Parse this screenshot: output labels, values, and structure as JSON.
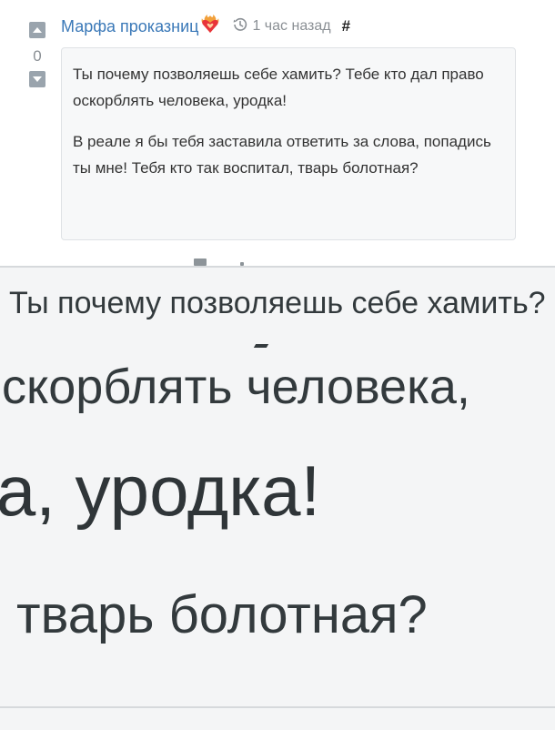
{
  "comment": {
    "author": "Марфа проказниц",
    "time": "1 час назад",
    "anchor": "#",
    "vote_count": "0",
    "paragraphs": [
      "Ты почему позволяешь себе хамить? Тебе кто дал право оскорблять человека, уродка!",
      "В реале я бы тебя заставила ответить за слова, попадись ты мне! Тебя кто так воспитал, тварь болотная?"
    ],
    "icons": {
      "upvote": "arrow-up-icon",
      "downvote": "arrow-down-icon",
      "emoji": "heart-on-fire-icon",
      "time": "history-icon"
    },
    "colors": {
      "author": "#3b79b8",
      "meta": "#8a8f94",
      "bubble_bg": "#f7f8f9",
      "bubble_border": "#dfe2e5",
      "heart": "#e8343a"
    }
  },
  "zoom": {
    "lines": [
      "Ты почему позволяешь себе хамить?",
      "оскорблять человека,",
      "ка, уродка!",
      "тварь болотная?"
    ]
  }
}
